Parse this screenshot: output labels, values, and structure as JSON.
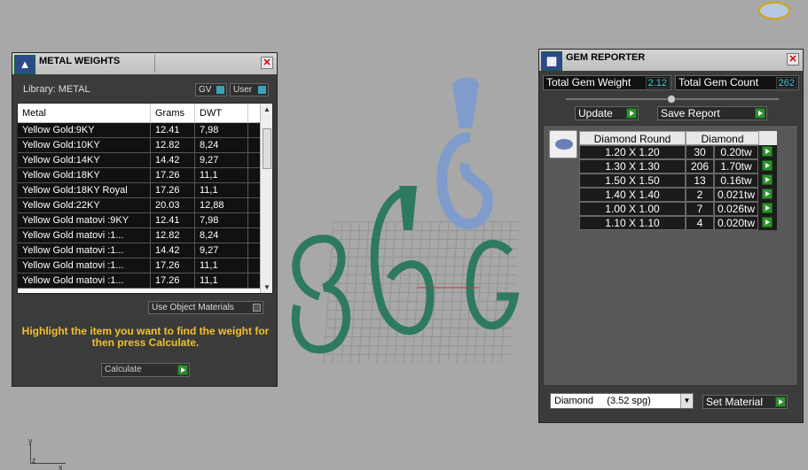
{
  "metal_panel": {
    "title": "METAL WEIGHTS",
    "library_label": "Library: METAL",
    "gv_label": "GV",
    "user_label": "User",
    "columns": [
      "Metal",
      "Grams",
      "DWT"
    ],
    "rows": [
      [
        "Yellow Gold:9KY",
        "12.41",
        "7,98"
      ],
      [
        "Yellow Gold:10KY",
        "12.82",
        "8,24"
      ],
      [
        "Yellow Gold:14KY",
        "14.42",
        "9,27"
      ],
      [
        "Yellow Gold:18KY",
        "17.26",
        "11,1"
      ],
      [
        "Yellow Gold:18KY Royal",
        "17.26",
        "11,1"
      ],
      [
        "Yellow Gold:22KY",
        "20.03",
        "12,88"
      ],
      [
        "Yellow Gold matovi :9KY",
        "12.41",
        "7,98"
      ],
      [
        "Yellow Gold matovi :1...",
        "12.82",
        "8,24"
      ],
      [
        "Yellow Gold matovi :1...",
        "14.42",
        "9,27"
      ],
      [
        "Yellow Gold matovi :1...",
        "17.26",
        "11,1"
      ],
      [
        "Yellow Gold matovi :1...",
        "17.26",
        "11,1"
      ]
    ],
    "use_object_materials": "Use Object Materials",
    "hint": "Highlight the item you want to find the weight for then press Calculate.",
    "calculate_label": "Calculate"
  },
  "gem_panel": {
    "title": "GEM REPORTER",
    "total_weight_label": "Total Gem Weight",
    "total_weight_value": "2.12",
    "total_count_label": "Total Gem Count",
    "total_count_value": "262",
    "update_label": "Update",
    "save_report_label": "Save Report",
    "columns": [
      "Diamond Round",
      "Diamond"
    ],
    "rows": [
      [
        "1.20 X 1.20",
        "30",
        "0.20tw"
      ],
      [
        "1.30 X 1.30",
        "206",
        "1.70tw"
      ],
      [
        "1.50 X 1.50",
        "13",
        "0.16tw"
      ],
      [
        "1.40 X 1.40",
        "2",
        "0.021tw"
      ],
      [
        "1.00 X 1.00",
        "7",
        "0.026tw"
      ],
      [
        "1.10 X 1.10",
        "4",
        "0.020tw"
      ]
    ],
    "material_select": "Diamond     (3.52 spg)",
    "set_material_label": "Set Material"
  },
  "axis": {
    "y": "y",
    "z": "z",
    "x": "x"
  }
}
